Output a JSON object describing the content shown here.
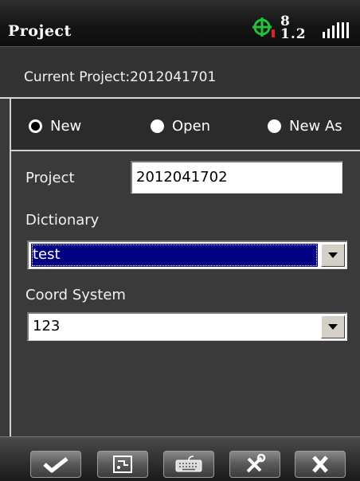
{
  "title_bar": {
    "title": "Project",
    "satellite_count": "8",
    "pdop": "1.2",
    "gps_icon": "gps-crosshair-icon",
    "signal_icon": "signal-strength-icon"
  },
  "current_project": {
    "text": "Current Project:2012041701"
  },
  "mode": {
    "options": [
      {
        "label": "New",
        "selected": true
      },
      {
        "label": "Open",
        "selected": false
      },
      {
        "label": "New As",
        "selected": false
      }
    ]
  },
  "form": {
    "project_label": "Project",
    "project_value": "2012041702",
    "dictionary_label": "Dictionary",
    "dictionary_value": "test",
    "coord_label": "Coord System",
    "coord_value": "123"
  },
  "toolbar": {
    "buttons": [
      {
        "name": "confirm",
        "icon": "checkmark-icon"
      },
      {
        "name": "device",
        "icon": "gps-receiver-icon"
      },
      {
        "name": "keyboard",
        "icon": "keyboard-icon"
      },
      {
        "name": "tools",
        "icon": "tools-icon"
      },
      {
        "name": "close",
        "icon": "close-icon"
      }
    ]
  },
  "colors": {
    "gps_icon": "#22c33a",
    "selection": "#000080",
    "background": "#3a3a3a"
  }
}
